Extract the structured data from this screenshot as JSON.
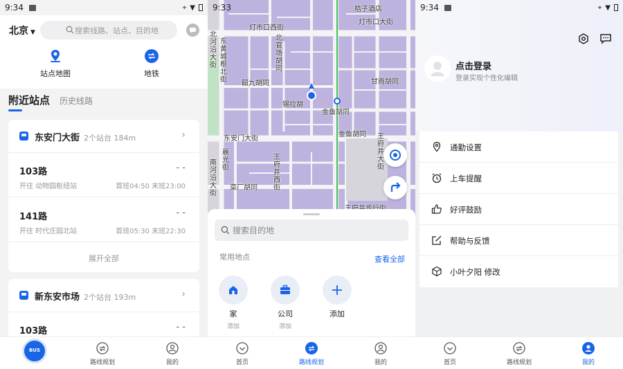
{
  "screen1": {
    "status_time": "9:34",
    "city": "北京",
    "search_placeholder": "搜索线路、站点、目的地",
    "quick_actions": [
      "站点地图",
      "地铁"
    ],
    "tabs": [
      "附近站点",
      "历史线路"
    ],
    "stations": [
      {
        "name": "东安门大街",
        "meta": "2个站台 184m",
        "lines": [
          {
            "line": "103路",
            "eta": "- -",
            "direction": "开往 动物园枢纽站",
            "schedule": "首班04:50 末班23:00"
          },
          {
            "line": "141路",
            "eta": "- -",
            "direction": "开往 时代庄园北站",
            "schedule": "首班05:30 末班22:30"
          }
        ],
        "expand": "展开全部"
      },
      {
        "name": "新东安市场",
        "meta": "2个站台 193m",
        "lines": [
          {
            "line": "103路",
            "eta": "- -"
          }
        ]
      }
    ],
    "fab_label": "BUS",
    "tabbar": [
      "路线规划",
      "我的"
    ]
  },
  "screen2": {
    "status_time": "9:33",
    "map_labels": {
      "top_poi": "桔子酒店",
      "dengshikou_west": "灯市口西街",
      "dengshikou_north": "灯市口大街",
      "dong_huangcheng_north": "东黄城根北街",
      "nanheyan": "北河沿大街",
      "beiguan": "北官场胡同",
      "shaojiu": "韶九胡同",
      "ganyu": "甘雨胡同",
      "xila": "锡拉胡",
      "jinyu": "金鱼胡同",
      "jinyu2": "金鱼胡同",
      "donganmen": "东安门大街",
      "chenguang": "晨光街",
      "wangfujing_west": "王府井西街",
      "nanheyan2": "南河沿大街",
      "wangfujing": "王府井大街",
      "caochang": "菜厂胡同",
      "walkstreet": "王府井步行街"
    },
    "search_placeholder": "搜索目的地",
    "common_places_label": "常用地点",
    "see_all": "查看全部",
    "places": [
      {
        "name": "家",
        "sub": "添加"
      },
      {
        "name": "公司",
        "sub": "添加"
      },
      {
        "name": "添加",
        "sub": ""
      }
    ],
    "tabbar": [
      "首页",
      "路线规划",
      "我的"
    ]
  },
  "screen3": {
    "status_time": "9:34",
    "login_title": "点击登录",
    "login_sub": "登录实现个性化编辑",
    "menu": [
      "通勤设置",
      "上车提醒",
      "好评鼓励",
      "帮助与反馈",
      "小叶夕阳 修改"
    ],
    "tabbar": [
      "首页",
      "路线规划",
      "我的"
    ]
  },
  "colors": {
    "accent": "#1a65e7",
    "map_block": "#bdb3de",
    "road": "#f4f3f6",
    "subway_line": "#3fbf5a"
  }
}
